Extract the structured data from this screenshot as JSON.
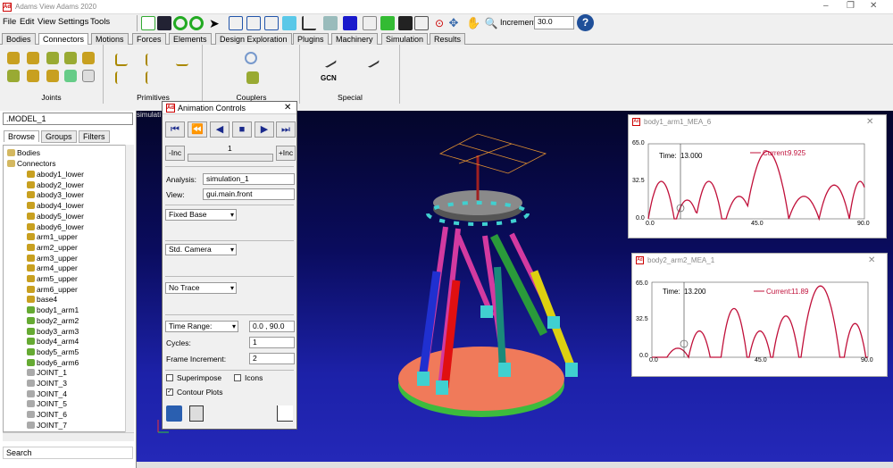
{
  "window": {
    "title": "Adams View Adams 2020",
    "min": "–",
    "restore": "❐",
    "close": "✕"
  },
  "menu": [
    "File",
    "Edit",
    "View",
    "Settings",
    "Tools"
  ],
  "toolbar": {
    "increment_label": "Increment",
    "increment_value": "30.0"
  },
  "tabs": [
    "Bodies",
    "Connectors",
    "Motions",
    "Forces",
    "Elements",
    "Design Exploration",
    "Plugins",
    "Machinery",
    "Simulation",
    "Results"
  ],
  "active_tab": "Connectors",
  "ribbon": {
    "groups": [
      "Joints",
      "Primitives",
      "Couplers",
      "Special"
    ],
    "gcn_label": "GCN"
  },
  "left": {
    "model": ".MODEL_1",
    "tabs": [
      "Browse",
      "Groups",
      "Filters"
    ],
    "tree": [
      "Bodies",
      "Connectors",
      "abody1_lower",
      "abody2_lower",
      "abody3_lower",
      "abody4_lower",
      "abody5_lower",
      "abody6_lower",
      "arm1_upper",
      "arm2_upper",
      "arm3_upper",
      "arm4_upper",
      "arm5_upper",
      "arm6_upper",
      "base4",
      "body1_arm1",
      "body2_arm2",
      "body3_arm3",
      "body4_arm4",
      "body5_arm5",
      "body6_arm6",
      "JOINT_1",
      "JOINT_3",
      "JOINT_4",
      "JOINT_5",
      "JOINT_6",
      "JOINT_7"
    ],
    "search": "Search"
  },
  "viewport": {
    "label": "simulati",
    "axis": "z"
  },
  "anim": {
    "title": "Animation Controls",
    "close": "✕",
    "dec": "-Inc",
    "inc": "+Inc",
    "frame": "1",
    "analysis_label": "Analysis:",
    "analysis": "simulation_1",
    "view_label": "View:",
    "view": "gui.main.front",
    "base": "Fixed Base",
    "camera": "Std. Camera",
    "trace": "No Trace",
    "range_label": "Time Range:",
    "range": "0.0 , 90.0",
    "cycles_label": "Cycles:",
    "cycles": "1",
    "frame_inc_label": "Frame Increment:",
    "frame_inc": "2",
    "superimpose": "Superimpose",
    "icons": "Icons",
    "contour": "Contour Plots"
  },
  "plots": [
    {
      "title": "body1_arm1_MEA_6",
      "time_label": "Time:",
      "time": "13.000",
      "current_label": "Current:",
      "current": "9.925",
      "yticks": [
        "65.0",
        "32.5",
        "0.0"
      ],
      "xticks": [
        "0.0",
        "45.0",
        "90.0"
      ]
    },
    {
      "title": "body2_arm2_MEA_1",
      "time_label": "Time:",
      "time": "13.200",
      "current_label": "Current:",
      "current": "11.89",
      "yticks": [
        "65.0",
        "32.5",
        "0.0"
      ],
      "xticks": [
        "0.0",
        "45.0",
        "90.0"
      ]
    }
  ],
  "colors": {
    "curve": "#c0103a",
    "platform": "#808080",
    "base": "#f07a5a",
    "ring": "#3dbb3d"
  }
}
